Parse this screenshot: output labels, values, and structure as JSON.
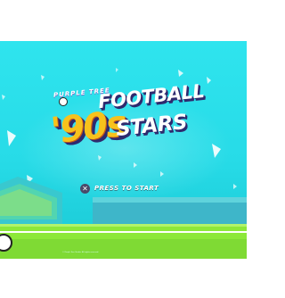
{
  "game": {
    "studio": "PURPLE TREE",
    "title_line1": "FOOTBALL",
    "title_number": "'90s",
    "title_line2": "STARS",
    "prompt_button": "✕",
    "prompt_label": "PRESS TO START",
    "copyright": "© Purple Tree Studio. All rights reserved."
  },
  "colors": {
    "sky": "#2fe4ee",
    "grass": "#8de83a",
    "logo_yellow": "#f7c21c",
    "logo_outline": "#2e2a6e"
  },
  "icons": {
    "ball": "football-icon",
    "prompt": "cross-button-icon"
  }
}
